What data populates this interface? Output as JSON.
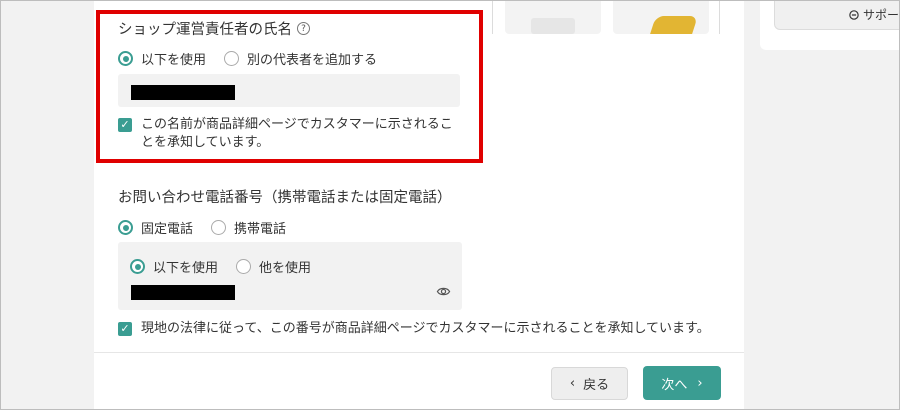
{
  "support": {
    "label": "サポー",
    "icon": "chat-icon"
  },
  "shop_manager": {
    "title": "ショップ運営責任者の氏名",
    "options": [
      {
        "label": "以下を使用",
        "selected": true
      },
      {
        "label": "別の代表者を追加する",
        "selected": false
      }
    ],
    "consent": "この名前が商品詳細ページでカスタマーに示されることを承知しています。",
    "consent_checked": true
  },
  "phone": {
    "title": "お問い合わせ電話番号（携帯電話または固定電話）",
    "type_options": [
      {
        "label": "固定電話",
        "selected": true
      },
      {
        "label": "携帯電話",
        "selected": false
      }
    ],
    "source_options": [
      {
        "label": "以下を使用",
        "selected": true
      },
      {
        "label": "他を使用",
        "selected": false
      }
    ],
    "consent": "現地の法律に従って、この番号が商品詳細ページでカスタマーに示されることを承知しています。",
    "consent_checked": true
  },
  "footer": {
    "back_label": "戻る",
    "next_label": "次へ"
  },
  "colors": {
    "accent": "#3a9d92",
    "highlight": "#e00000"
  }
}
